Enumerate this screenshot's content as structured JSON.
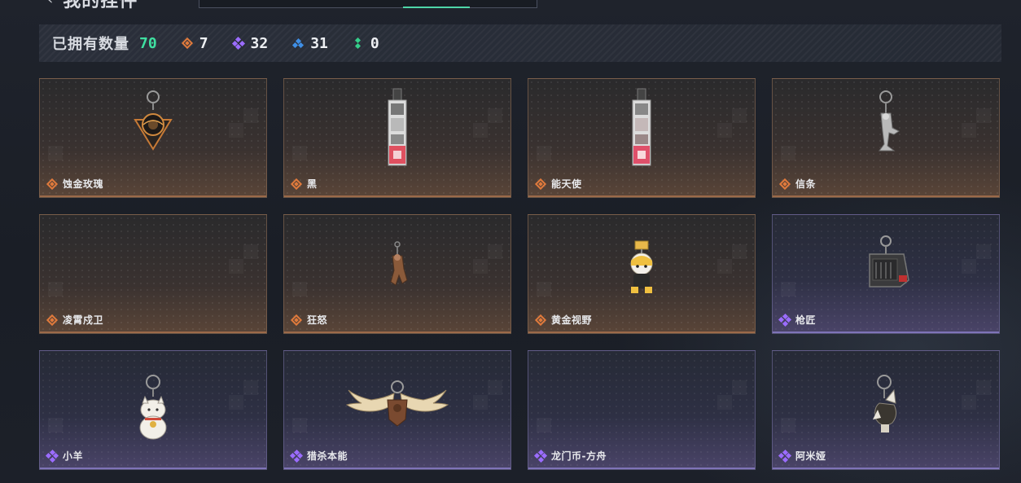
{
  "header": {
    "title": "我的挂件",
    "back_icon": "chevron-left-icon"
  },
  "stats": {
    "owned_label": "已拥有数量",
    "owned_count": "70",
    "orange_count": "7",
    "purple_count": "32",
    "blue_count": "31",
    "green_count": "0",
    "colors": {
      "accent_green": "#3fe0a1",
      "orange": "#e07a3c",
      "purple": "#9b6cff",
      "blue": "#3f8fe6",
      "green": "#35cf8a"
    }
  },
  "items": [
    {
      "name": "蚀金玫瑰",
      "rarity": "orange",
      "icon": "rose-pendant-icon"
    },
    {
      "name": "黑",
      "rarity": "orange",
      "icon": "photo-strip-icon"
    },
    {
      "name": "能天使",
      "rarity": "orange",
      "icon": "photo-strip-icon"
    },
    {
      "name": "信条",
      "rarity": "orange",
      "icon": "figure-pendant-icon"
    },
    {
      "name": "凌霄戍卫",
      "rarity": "orange",
      "icon": "empty-slot"
    },
    {
      "name": "狂怒",
      "rarity": "orange",
      "icon": "figure-pendant-icon"
    },
    {
      "name": "黄金视野",
      "rarity": "orange",
      "icon": "chibi-figure-icon"
    },
    {
      "name": "枪匠",
      "rarity": "purple",
      "icon": "gun-case-icon"
    },
    {
      "name": "小羊",
      "rarity": "purple",
      "icon": "lucky-cat-icon"
    },
    {
      "name": "猎杀本能",
      "rarity": "purple",
      "icon": "moose-antler-icon"
    },
    {
      "name": "龙门币-方舟",
      "rarity": "purple",
      "icon": "empty-slot"
    },
    {
      "name": "阿米娅",
      "rarity": "purple",
      "icon": "bunny-ears-icon"
    }
  ]
}
